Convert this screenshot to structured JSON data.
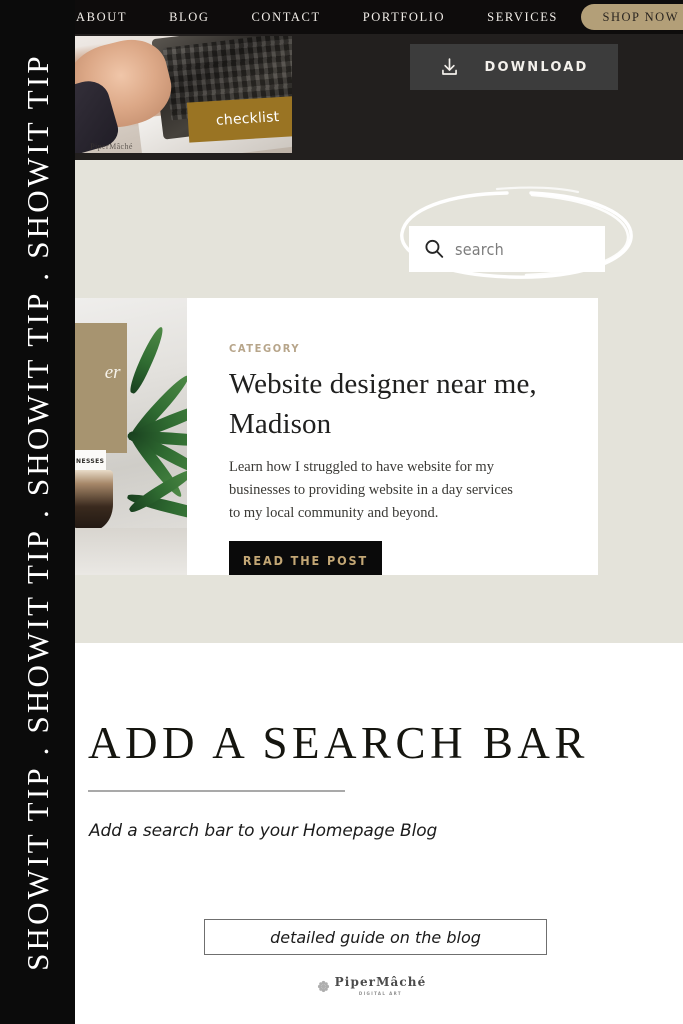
{
  "rail": {
    "text": "SHOWIT TIP . SHOWIT TIP . SHOWIT TIP . SHOWIT TIP"
  },
  "nav": {
    "items": [
      {
        "label": "ABOUT",
        "name": "nav-link-about"
      },
      {
        "label": "BLOG",
        "name": "nav-link-blog"
      },
      {
        "label": "CONTACT",
        "name": "nav-link-contact"
      },
      {
        "label": "PORTFOLIO",
        "name": "nav-link-portfolio"
      },
      {
        "label": "SERVICES",
        "name": "nav-link-services"
      }
    ],
    "shop_label": "SHOP NOW"
  },
  "hero": {
    "thumb_badge": "checklist",
    "thumb_watermark": "PiperMâché",
    "download_label": "DOWNLOAD",
    "download_icon": "download-icon"
  },
  "search": {
    "placeholder": "search",
    "icon": "search-icon",
    "annotation": "hand-drawn-circle-highlight"
  },
  "card": {
    "category": "CATEGORY",
    "title": "Website designer near me, Madison",
    "excerpt": "Learn how I struggled to have website for my businesses to providing website in a day services to my local community and beyond.",
    "button_label": "READ THE POST",
    "photo_card_text": "er",
    "photo_chip_text": "NESSES"
  },
  "footer": {
    "title": "ADD A SEARCH BAR",
    "subtitle": "Add a search bar to your Homepage Blog",
    "cta_label": "detailed guide on the blog",
    "logo_name": "PiperMâché",
    "logo_tagline": "DIGITAL ART",
    "logo_mark": "rosette-icon"
  },
  "colors": {
    "rail_bg": "#0b0b0b",
    "navbar_bg": "#0e0c0c",
    "dark_top_bg": "#221f1e",
    "beige_bg": "#e4e3da",
    "shop_pill": "#b39f78",
    "download_bg": "#3c3c3c",
    "checklist_badge": "#9a7423",
    "category_gold": "#b7a58a",
    "read_btn_text": "#c3a775",
    "white": "#ffffff"
  }
}
